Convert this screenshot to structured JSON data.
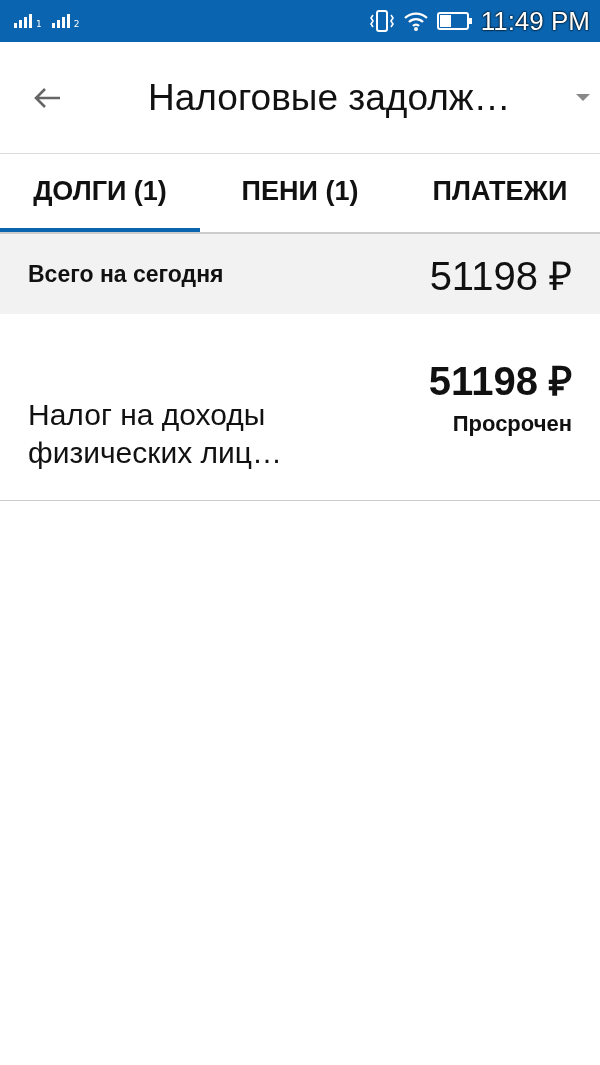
{
  "status_bar": {
    "sims": [
      "1",
      "2"
    ],
    "time": "11:49 PM"
  },
  "app_bar": {
    "title": "Налоговые задолж…"
  },
  "tabs": [
    {
      "label": "ДОЛГИ (1)",
      "selected": true
    },
    {
      "label": "ПЕНИ (1)",
      "selected": false
    },
    {
      "label": "ПЛАТЕЖИ",
      "selected": false
    }
  ],
  "summary": {
    "label": "Всего на сегодня",
    "amount": "51198 ₽"
  },
  "debts": [
    {
      "name": "Налог на доходы физических лиц…",
      "amount": "51198 ₽",
      "status": "Просрочен"
    }
  ]
}
